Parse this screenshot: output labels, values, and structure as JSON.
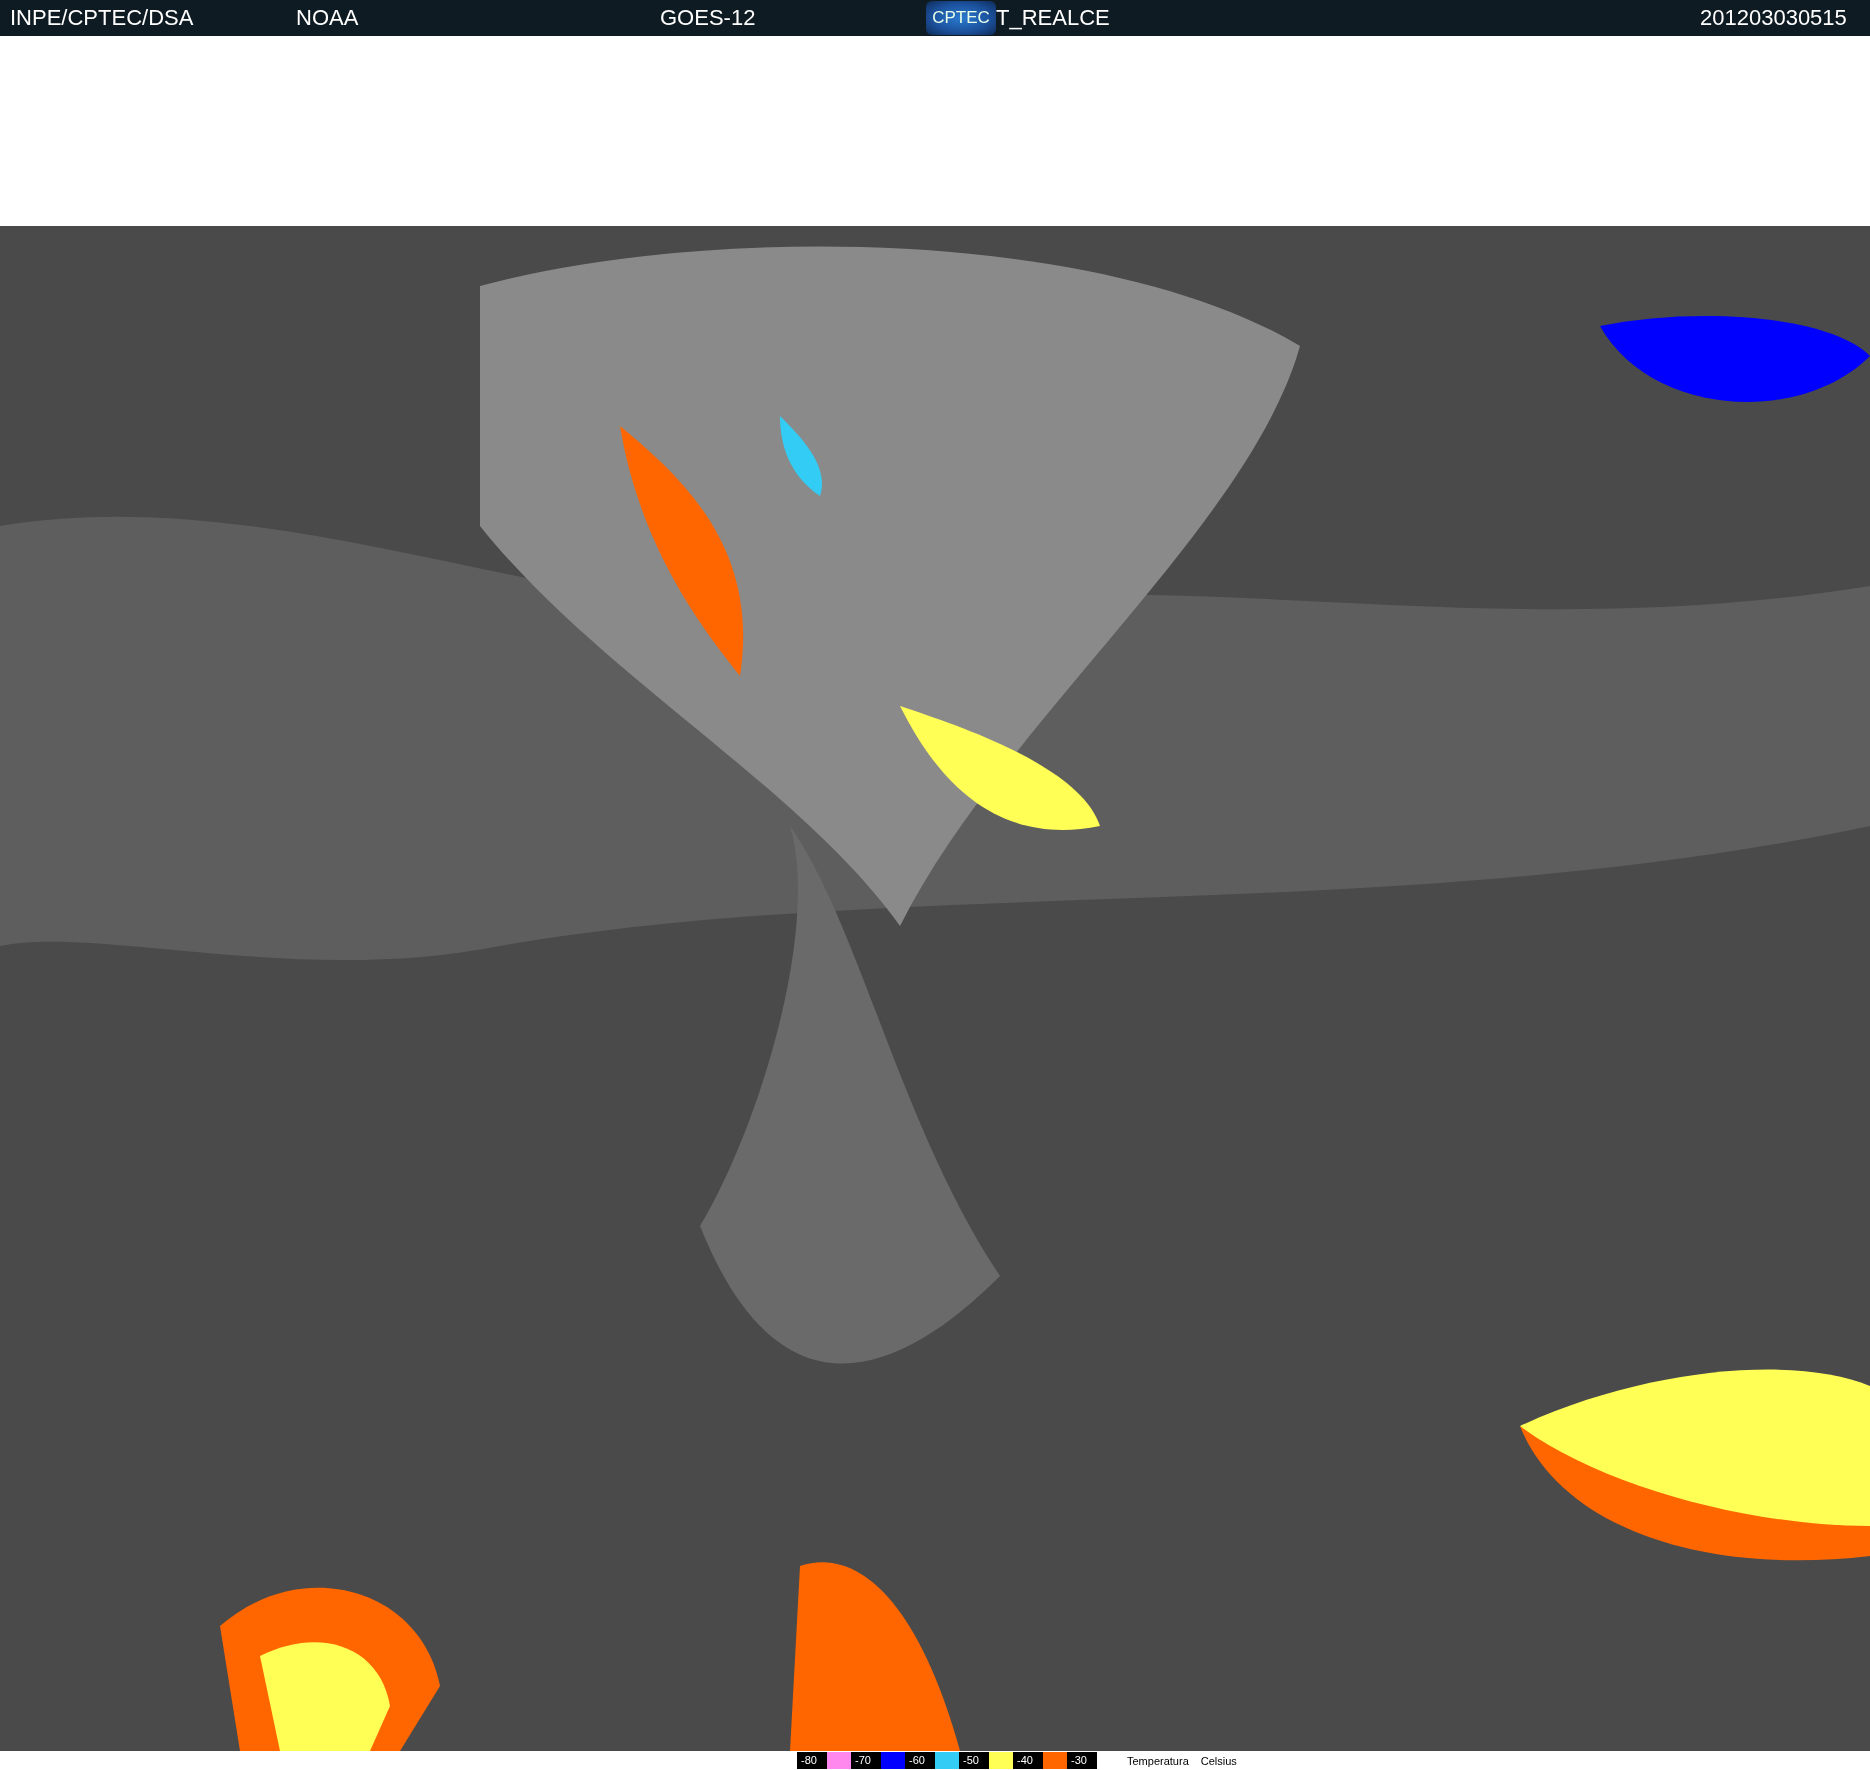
{
  "header": {
    "source": "INPE/CPTEC/DSA",
    "agency": "NOAA",
    "satellite": "GOES-12",
    "logo": "CPTEC",
    "product": "T_REALCE",
    "timestamp": "201203030515"
  },
  "legend": {
    "items": [
      {
        "label": "-80",
        "color": "#ff88ee"
      },
      {
        "label": "-70",
        "color": "#0000ff"
      },
      {
        "label": "-60",
        "color": "#33ccf5"
      },
      {
        "label": "-50",
        "color": "#ffff55"
      },
      {
        "label": "-40",
        "color": "#ff6600"
      },
      {
        "label": "-30"
      }
    ],
    "quantity": "Temperatura",
    "unit": "Celsius"
  }
}
